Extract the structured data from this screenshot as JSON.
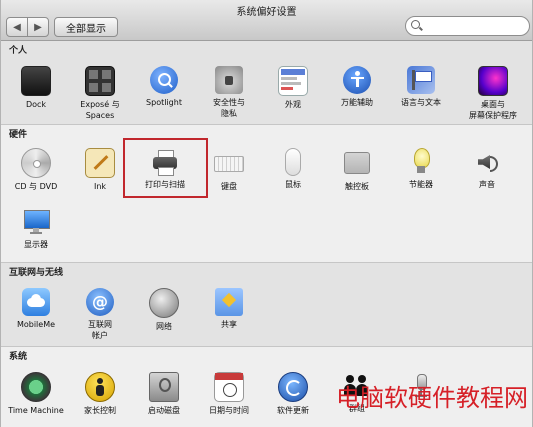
{
  "window": {
    "title": "系统偏好设置"
  },
  "toolbar": {
    "back_label": "◀",
    "forward_label": "▶",
    "showall_label": "全部显示"
  },
  "sections": [
    {
      "title": "个人",
      "items": [
        {
          "name": "Dock",
          "label": [
            "Dock"
          ]
        },
        {
          "name": "Expose & Spaces",
          "label": [
            "Exposé 与",
            "Spaces"
          ]
        },
        {
          "name": "Spotlight",
          "label": [
            "Spotlight"
          ]
        },
        {
          "name": "Security & Privacy",
          "label": [
            "安全性与",
            "隐私"
          ]
        },
        {
          "name": "Appearance",
          "label": [
            "外观"
          ]
        },
        {
          "name": "Universal Access",
          "label": [
            "万能辅助"
          ]
        },
        {
          "name": "Language & Text",
          "label": [
            "语言与文本"
          ]
        },
        {
          "name": "Desktop & Screen Saver",
          "label": [
            "桌面与",
            "屏幕保护程序"
          ]
        }
      ]
    },
    {
      "title": "硬件",
      "items": [
        {
          "name": "CD & DVD",
          "label": [
            "CD 与 DVD"
          ]
        },
        {
          "name": "Ink",
          "label": [
            "Ink"
          ]
        },
        {
          "name": "Print & Scan",
          "label": [
            "打印与扫描"
          ]
        },
        {
          "name": "Keyboard",
          "label": [
            "键盘"
          ]
        },
        {
          "name": "Mouse",
          "label": [
            "鼠标"
          ]
        },
        {
          "name": "Trackpad",
          "label": [
            "触控板"
          ]
        },
        {
          "name": "Energy Saver",
          "label": [
            "节能器"
          ]
        },
        {
          "name": "Sound",
          "label": [
            "声音"
          ]
        },
        {
          "name": "Displays",
          "label": [
            "显示器"
          ]
        }
      ]
    },
    {
      "title": "互联网与无线",
      "items": [
        {
          "name": "MobileMe",
          "label": [
            "MobileMe"
          ]
        },
        {
          "name": "Internet Accounts",
          "label": [
            "互联网",
            "帐户"
          ]
        },
        {
          "name": "Network",
          "label": [
            "网络"
          ]
        },
        {
          "name": "Sharing",
          "label": [
            "共享"
          ]
        }
      ]
    },
    {
      "title": "系统",
      "items": [
        {
          "name": "Time Machine",
          "label": [
            "Time Machine"
          ]
        },
        {
          "name": "Parental Controls",
          "label": [
            "家长控制"
          ]
        },
        {
          "name": "Startup Disk",
          "label": [
            "启动磁盘"
          ]
        },
        {
          "name": "Date & Time",
          "label": [
            "日期与时间"
          ]
        },
        {
          "name": "Software Update",
          "label": [
            "软件更新"
          ]
        },
        {
          "name": "Users & Groups",
          "label": [
            "群组"
          ]
        },
        {
          "name": "Speech",
          "label": [
            ""
          ]
        }
      ]
    }
  ],
  "watermark": "电脑软硬件教程网"
}
